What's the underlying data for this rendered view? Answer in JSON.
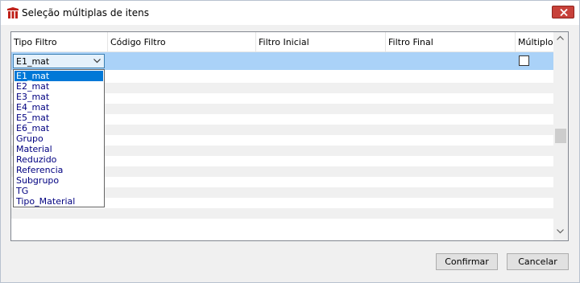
{
  "window": {
    "title": "Seleção múltiplas de itens",
    "icon": "app-logo-icon",
    "close_icon": "close-icon"
  },
  "grid": {
    "columns": [
      "Tipo Filtro",
      "Código Filtro",
      "Filtro Inicial",
      "Filtro Final",
      "Múltiplo"
    ],
    "selected_row": {
      "tipo_filtro": "E1_mat",
      "multiplo_checked": false
    }
  },
  "dropdown": {
    "options": [
      "E1_mat",
      "E2_mat",
      "E3_mat",
      "E4_mat",
      "E5_mat",
      "E6_mat",
      "Grupo",
      "Material",
      "Reduzido",
      "Referencia",
      "Subgrupo",
      "TG",
      "Tipo_Material"
    ],
    "selected_index": 0
  },
  "buttons": {
    "confirm_label": "Confirmar",
    "cancel_label": "Cancelar"
  },
  "colors": {
    "selected_row": "#aad2f8",
    "highlight": "#0078d7",
    "option_text": "#000080",
    "close_button": "#c7413a"
  }
}
